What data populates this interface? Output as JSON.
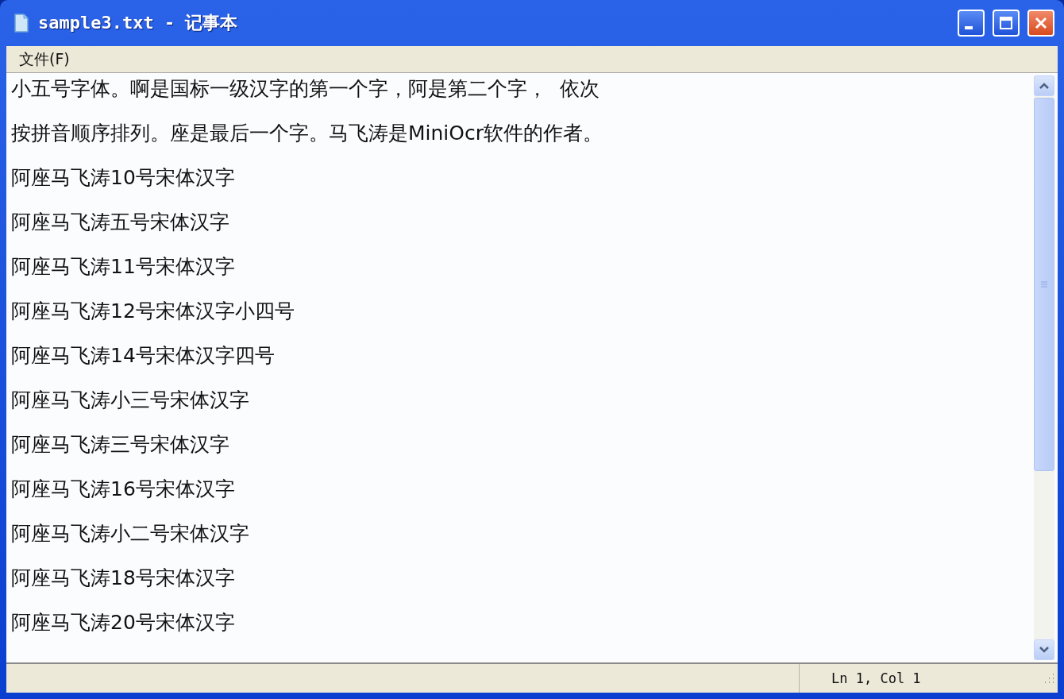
{
  "window": {
    "title": "sample3.txt - 记事本"
  },
  "menu": [
    {
      "label": "文件(F)"
    }
  ],
  "editor": {
    "lines": [
      "小五号字体。啊是国标一级汉字的第一个字，阿是第二个字，  依次",
      "按拼音顺序排列。座是最后一个字。马飞涛是MiniOcr软件的作者。",
      "阿座马飞涛10号宋体汉字",
      "阿座马飞涛五号宋体汉字",
      "阿座马飞涛11号宋体汉字",
      "阿座马飞涛12号宋体汉字小四号",
      "阿座马飞涛14号宋体汉字四号",
      "阿座马飞涛小三号宋体汉字",
      "阿座马飞涛三号宋体汉字",
      "阿座马飞涛16号宋体汉字",
      "阿座马飞涛小二号宋体汉字",
      "阿座马飞涛18号宋体汉字",
      "阿座马飞涛20号宋体汉字"
    ]
  },
  "status_bar": {
    "position": "Ln 1, Col 1"
  }
}
